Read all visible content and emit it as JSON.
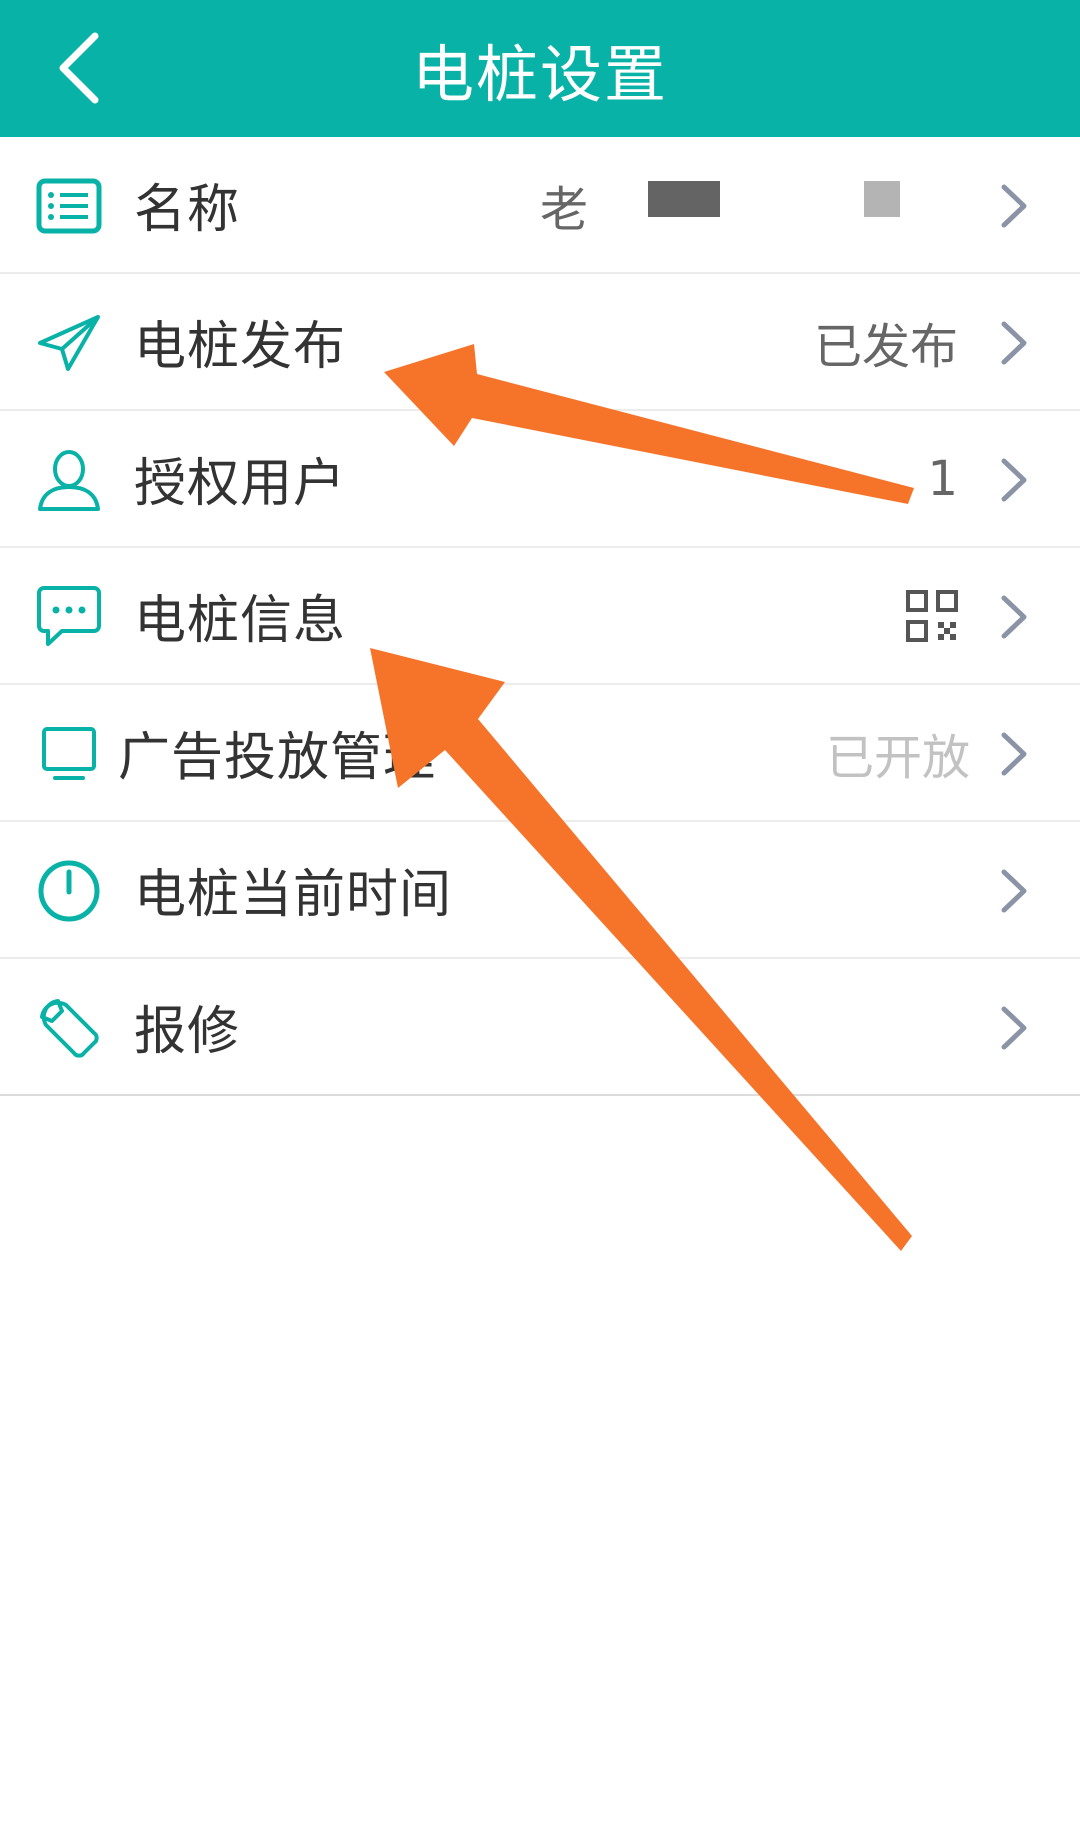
{
  "header": {
    "title": "电桩设置",
    "accent_color": "#08b2a6"
  },
  "icons": {
    "back": "chevron-left-icon",
    "name": "list-icon",
    "publish": "paper-plane-icon",
    "users": "user-icon",
    "info": "chat-bubble-icon",
    "ads": "monitor-icon",
    "time": "clock-icon",
    "repair": "wrench-icon",
    "qr": "qr-code-icon"
  },
  "settings": {
    "items": [
      {
        "label": "名称",
        "value": "老"
      },
      {
        "label": "电桩发布",
        "value": "已发布"
      },
      {
        "label": "授权用户",
        "value": "1"
      },
      {
        "label": "电桩信息",
        "value": ""
      },
      {
        "label": "广告投放管理",
        "value": "已开放"
      },
      {
        "label": "电桩当前时间",
        "value": ""
      },
      {
        "label": "报修",
        "value": ""
      }
    ]
  },
  "annotation": {
    "arrow_color": "#f5742a"
  }
}
